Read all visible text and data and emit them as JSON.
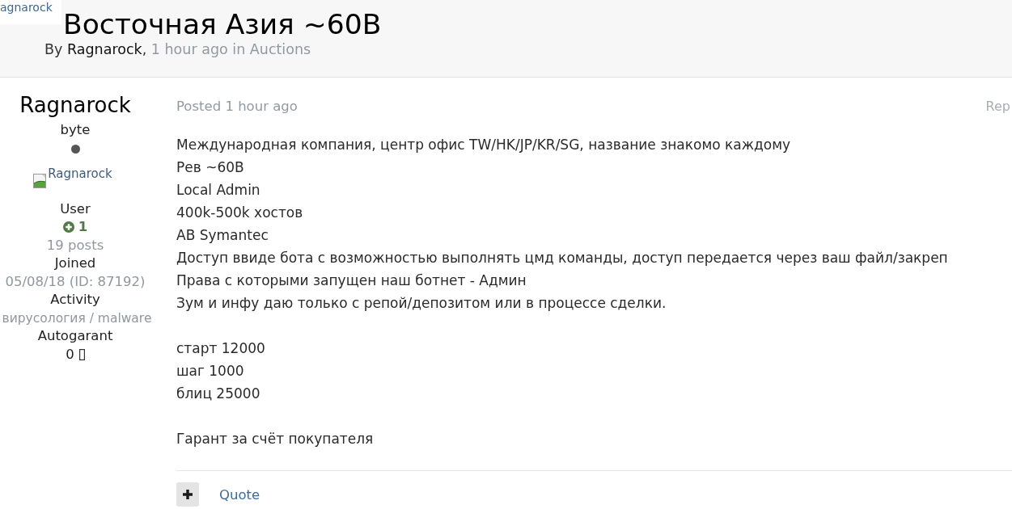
{
  "header": {
    "avatar_alt": "agnarock",
    "title": "Восточная Азия ~60B",
    "byline": {
      "prefix": "By",
      "author": "Ragnarock",
      "separator": ",",
      "time": "1 hour ago",
      "forum_prefix": "in",
      "forum": "Auctions"
    }
  },
  "author_panel": {
    "name": "Ragnarock",
    "rank": "byte",
    "online": false,
    "avatar_alt": "Ragnarock",
    "group": "User",
    "reputation": "1",
    "posts": "19 posts",
    "fields": [
      {
        "label": "Joined",
        "value": "05/08/18 (ID: 87192)"
      },
      {
        "label": "Activity",
        "value": "вирусология / malware"
      }
    ],
    "autogarant": {
      "label": "Autogarant",
      "value": "0"
    }
  },
  "post": {
    "posted": "Posted 1 hour ago",
    "report": "Rep",
    "paragraphs": [
      [
        "Международная компания, центр офис TW/HK/JP/KR/SG, название знакомо каждому",
        "Рев ~60B",
        "Local Admin",
        "400k-500k хостов",
        "AB Symantec",
        "Доступ ввиде бота с возможностью выполнять цмд команды, доступ передается через ваш файл/закреп",
        "Права с которыми запущен наш ботнет - Админ",
        "Зум и инфу даю только с репой/депозитом или в процессе сделки."
      ],
      [
        "старт 12000",
        "шаг 1000",
        "блиц 25000"
      ],
      [
        "Гарант за счёт покупателя"
      ]
    ],
    "quote": "Quote"
  }
}
